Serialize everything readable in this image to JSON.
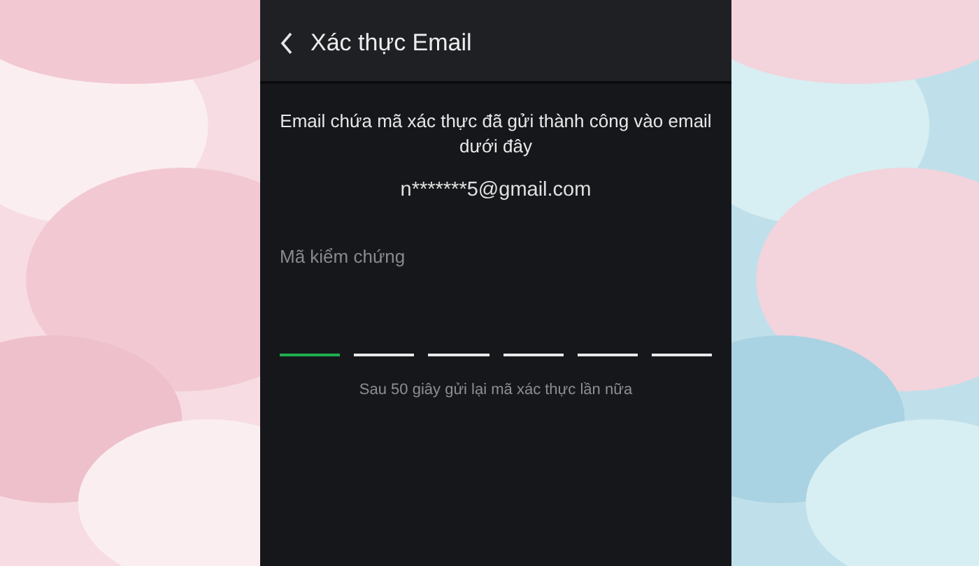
{
  "header": {
    "back_icon": true,
    "title": "Xác thực Email"
  },
  "message": "Email chứa mã xác thực đã gửi thành công vào email dưới đây",
  "email": "n*******5@gmail.com",
  "code_field": {
    "label": "Mã kiểm chứng",
    "slots": [
      {
        "focused": true
      },
      {
        "focused": false
      },
      {
        "focused": false
      },
      {
        "focused": false
      },
      {
        "focused": false
      },
      {
        "focused": false
      }
    ]
  },
  "resend_note": "Sau 50 giây gửi lại mã xác thực lần nữa"
}
